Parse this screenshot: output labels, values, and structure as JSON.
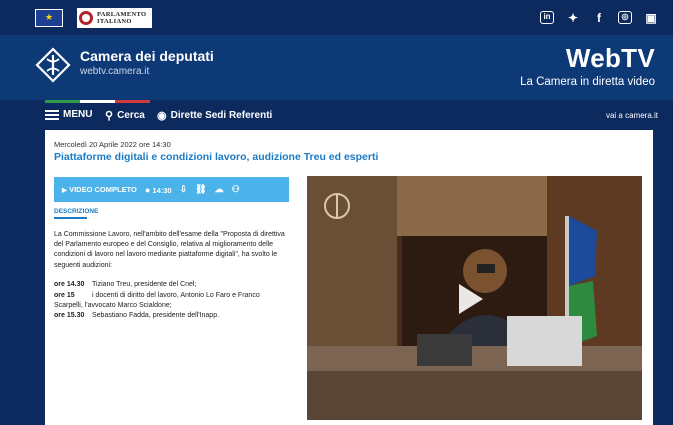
{
  "topbar": {
    "parlamento_line1": "PARLAMENTO",
    "parlamento_line2": "ITALIANO",
    "socials": [
      "linkedin",
      "twitter",
      "facebook",
      "instagram",
      "youtube"
    ]
  },
  "header": {
    "site_name": "Camera dei deputati",
    "site_url": "webtv.camera.it",
    "brand": "WebTV",
    "tagline": "La Camera in diretta video"
  },
  "nav": {
    "menu": "MENU",
    "search": "Cerca",
    "live": "Dirette Sedi Referenti",
    "external": "vai a camera.it"
  },
  "event": {
    "date": "Mercoledì 20 Aprile 2022 ore 14:30",
    "title": "Piattaforme digitali e condizioni lavoro, audizione Treu ed esperti"
  },
  "video_bar": {
    "label": "VIDEO COMPLETO",
    "time": "14:30"
  },
  "description": {
    "tab_label": "DESCRIZIONE",
    "body": "La Commissione Lavoro, nell'ambito dell'esame della \"Proposta di direttiva del Parlamento europeo e del Consiglio, relativa al miglioramento delle condizioni di lavoro nel lavoro mediante piattaforme digitali\", ha svolto le seguenti audizioni:",
    "schedule": [
      {
        "time": "ore 14.30",
        "text": "Tiziano Treu, presidente del Cnel;"
      },
      {
        "time": "ore 15",
        "text": "i docenti di diritto del lavoro, Antonio Lo Faro e Franco Scarpelli, l'avvocato Marco Scialdone;"
      },
      {
        "time": "ore 15.30",
        "text": "Sebastiano Fadda, presidente dell'Inapp."
      }
    ]
  },
  "colors": {
    "navy": "#0c2a5e",
    "header_blue": "#0e3977",
    "accent": "#1b7bc4",
    "video_bar": "#4bb3e9"
  }
}
